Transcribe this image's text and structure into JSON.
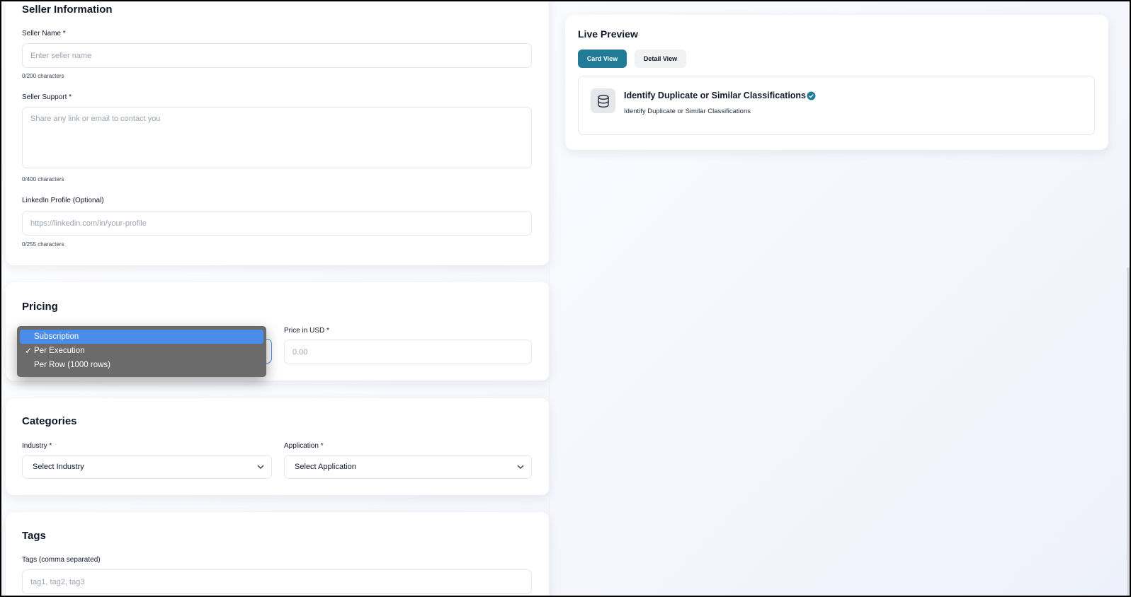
{
  "seller": {
    "section_title": "Seller Information",
    "name_label": "Seller Name *",
    "name_placeholder": "Enter seller name",
    "name_counter": "0/200 characters",
    "support_label": "Seller Support *",
    "support_placeholder": "Share any link or email to contact you",
    "support_counter": "0/400 characters",
    "linkedin_label": "LinkedIn Profile (Optional)",
    "linkedin_placeholder": "https://linkedin.com/in/your-profile",
    "linkedin_counter": "0/255 characters"
  },
  "pricing": {
    "section_title": "Pricing",
    "price_label": "Price in USD *",
    "price_placeholder": "0.00",
    "model_dropdown": {
      "options": [
        {
          "label": "Subscription",
          "highlighted": true,
          "checked": false
        },
        {
          "label": "Per Execution",
          "highlighted": false,
          "checked": true
        },
        {
          "label": "Per Row (1000 rows)",
          "highlighted": false,
          "checked": false
        }
      ],
      "check_glyph": "✓"
    }
  },
  "categories": {
    "section_title": "Categories",
    "industry_label": "Industry *",
    "industry_value": "Select Industry",
    "application_label": "Application *",
    "application_value": "Select Application"
  },
  "tags": {
    "section_title": "Tags",
    "tags_label": "Tags (comma separated)",
    "tags_placeholder": "tag1, tag2, tag3"
  },
  "preview": {
    "title": "Live Preview",
    "tabs": {
      "card_view": "Card View",
      "detail_view": "Detail View"
    },
    "active_tab": "card_view",
    "card_title": "Identify Duplicate or Similar Classifications",
    "card_subtitle": "Identify Duplicate or Similar Classifications",
    "card_icon": "database-icon",
    "badge_icon": "verified-check-icon"
  },
  "colors": {
    "accent": "#217a96",
    "dropdown_bg": "#6b6b6b",
    "dropdown_highlight": "#4a8de8",
    "secondary_tab_bg": "#f1f2f4"
  }
}
